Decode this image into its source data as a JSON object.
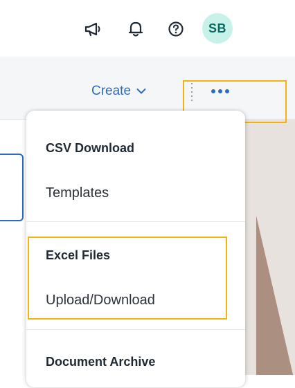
{
  "shellbar": {
    "icons": [
      "megaphone-icon",
      "bell-icon",
      "help-icon"
    ],
    "avatar_initials": "SB"
  },
  "toolbar": {
    "create_label": "Create",
    "create_chevron": "chevron-down-icon",
    "overflow_icon": "more-horizontal-icon"
  },
  "menu": {
    "groups": [
      {
        "heading": "CSV Download",
        "item": "Templates"
      },
      {
        "heading": "Excel Files",
        "item": "Upload/Download"
      },
      {
        "heading": "Document Archive"
      }
    ]
  },
  "colors": {
    "accent": "#2c6bbd",
    "highlight": "#f2b311",
    "avatar_bg": "#c8f1ea",
    "avatar_text": "#0b6a62"
  }
}
